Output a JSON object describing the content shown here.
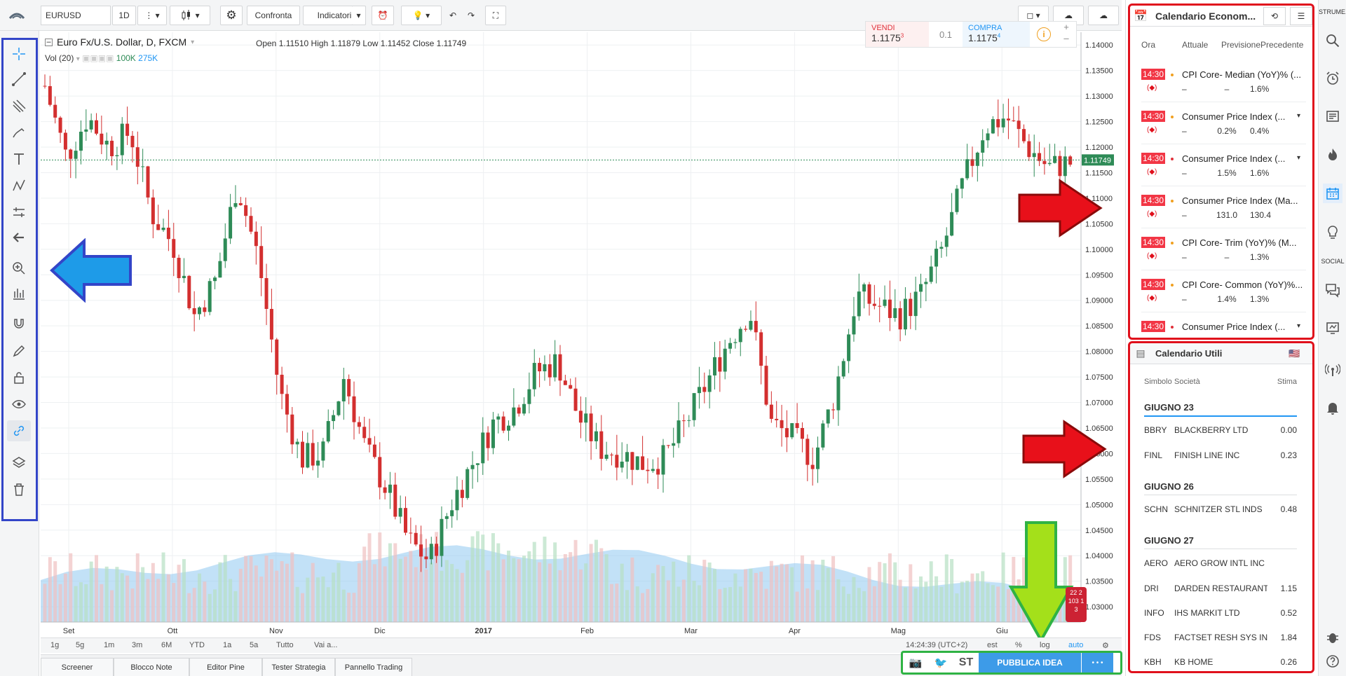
{
  "toolbar": {
    "symbol": "EURUSD",
    "interval": "1D",
    "compare_label": "Confronta",
    "indicators_label": "Indicatori"
  },
  "legend": {
    "title": "Euro Fx/U.S. Dollar, D, FXCM",
    "open_label": "Open",
    "open": "1.11510",
    "high_label": "High",
    "high": "1.11879",
    "low_label": "Low",
    "low": "1.11452",
    "close_label": "Close",
    "close": "1.11749",
    "volume_label": "Vol (20)",
    "volume_a": "100K",
    "volume_b": "275K"
  },
  "trade": {
    "sell_label": "VENDI",
    "sell_price": "1.1175",
    "sell_sup": "3",
    "spread": "0.1",
    "buy_label": "COMPRA",
    "buy_price": "1.1175",
    "buy_sup": "4"
  },
  "chart_data": {
    "type": "candlestick",
    "y_ticks": [
      "1.14000",
      "1.13500",
      "1.13000",
      "1.12500",
      "1.12000",
      "1.11500",
      "1.11000",
      "1.10500",
      "1.10000",
      "1.09500",
      "1.09000",
      "1.08500",
      "1.08000",
      "1.07500",
      "1.07000",
      "1.06500",
      "1.06000",
      "1.05500",
      "1.05000",
      "1.04500",
      "1.04000",
      "1.03500",
      "1.03000"
    ],
    "ylim": [
      1.027,
      1.1425
    ],
    "x_labels": [
      "Set",
      "Ott",
      "Nov",
      "Dic",
      "2017",
      "Feb",
      "Mar",
      "Apr",
      "Mag",
      "Giu"
    ],
    "last_price_label": "1.11749",
    "last_price": 1.11749,
    "approx_path": [
      1.132,
      1.118,
      1.126,
      1.12,
      1.123,
      1.107,
      1.101,
      1.087,
      1.094,
      1.113,
      1.098,
      1.072,
      1.059,
      1.06,
      1.075,
      1.061,
      1.053,
      1.043,
      1.039,
      1.05,
      1.058,
      1.066,
      1.069,
      1.076,
      1.078,
      1.067,
      1.061,
      1.06,
      1.058,
      1.059,
      1.066,
      1.074,
      1.082,
      1.088,
      1.066,
      1.063,
      1.059,
      1.072,
      1.091,
      1.089,
      1.087,
      1.091,
      1.1,
      1.113,
      1.124,
      1.126,
      1.12,
      1.116,
      1.117
    ]
  },
  "range_bar": {
    "ranges": [
      "1g",
      "5g",
      "1m",
      "3m",
      "6M",
      "YTD",
      "1a",
      "5a",
      "Tutto",
      "Vai a..."
    ],
    "clock": "14:24:39 (UTC+2)",
    "ext": "est",
    "pct": "%",
    "log": "log",
    "auto": "auto"
  },
  "bottom_tabs": [
    "Screener",
    "Blocco Note",
    "Editor Pine",
    "Tester Strategia",
    "Pannello Trading"
  ],
  "publish": {
    "st": "ST",
    "label": "PUBBLICA IDEA",
    "more": "• • •"
  },
  "econ_calendar": {
    "title": "Calendario Econom...",
    "col_time": "Ora",
    "col_actual": "Attuale",
    "col_forecast": "Previsione",
    "col_previous": "Precedente",
    "events": [
      {
        "time": "14:30",
        "title": "CPI Core- Median (YoY)% (...",
        "actual": "–",
        "forecast": "–",
        "previous": "1.6%",
        "dot": "#f0a020"
      },
      {
        "time": "14:30",
        "title": "Consumer Price Index (...",
        "actual": "–",
        "forecast": "0.2%",
        "previous": "0.4%",
        "dot": "#f0a020"
      },
      {
        "time": "14:30",
        "title": "Consumer Price Index (...",
        "actual": "–",
        "forecast": "1.5%",
        "previous": "1.6%",
        "dot": "#e0303a"
      },
      {
        "time": "14:30",
        "title": "Consumer Price Index (Ma...",
        "actual": "–",
        "forecast": "131.0",
        "previous": "130.4",
        "dot": "#f0a020"
      },
      {
        "time": "14:30",
        "title": "CPI Core- Trim (YoY)% (M...",
        "actual": "–",
        "forecast": "–",
        "previous": "1.3%",
        "dot": "#f0a020"
      },
      {
        "time": "14:30",
        "title": "CPI Core- Common (YoY)%...",
        "actual": "–",
        "forecast": "1.4%",
        "previous": "1.3%",
        "dot": "#f0a020"
      },
      {
        "time": "14:30",
        "title": "Consumer Price Index (...",
        "actual": "",
        "forecast": "",
        "previous": "",
        "dot": "#e0303a"
      }
    ]
  },
  "earnings_calendar": {
    "title": "Calendario Utili",
    "col_symbol": "Simbolo",
    "col_company": "Società",
    "col_estimate": "Stima",
    "groups": [
      {
        "date": "GIUGNO 23",
        "rows": [
          {
            "symbol": "BBRY",
            "company": "BLACKBERRY LTD",
            "estimate": "0.00"
          },
          {
            "symbol": "FINL",
            "company": "FINISH LINE INC",
            "estimate": "0.23"
          }
        ]
      },
      {
        "date": "GIUGNO 26",
        "rows": [
          {
            "symbol": "SCHN",
            "company": "SCHNITZER STL INDS",
            "estimate": "0.48"
          }
        ]
      },
      {
        "date": "GIUGNO 27",
        "rows": [
          {
            "symbol": "AERO",
            "company": "AERO GROW INTL INC",
            "estimate": ""
          },
          {
            "symbol": "DRI",
            "company": "DARDEN RESTAURANTS II",
            "estimate": "1.15"
          },
          {
            "symbol": "INFO",
            "company": "IHS MARKIT LTD",
            "estimate": "0.52"
          },
          {
            "symbol": "FDS",
            "company": "FACTSET RESH SYS INC",
            "estimate": "1.84"
          },
          {
            "symbol": "KBH",
            "company": "KB HOME",
            "estimate": "0.26"
          }
        ]
      }
    ]
  },
  "far_right": {
    "top_label": "STRUME...",
    "social_label": "SOCIAL"
  },
  "overlay_tag": {
    "line1": "22 2",
    "line2": "103 1 3"
  },
  "colors": {
    "up": "#2e8b57",
    "down": "#d32f2f",
    "accent": "#2196f3",
    "highlight_red": "#e0101c",
    "highlight_blue": "#3345c8",
    "highlight_green": "#2fb344",
    "arrow_red": "#e8101a",
    "arrow_blue": "#1e9be8",
    "arrow_green": "#a4e01a"
  }
}
